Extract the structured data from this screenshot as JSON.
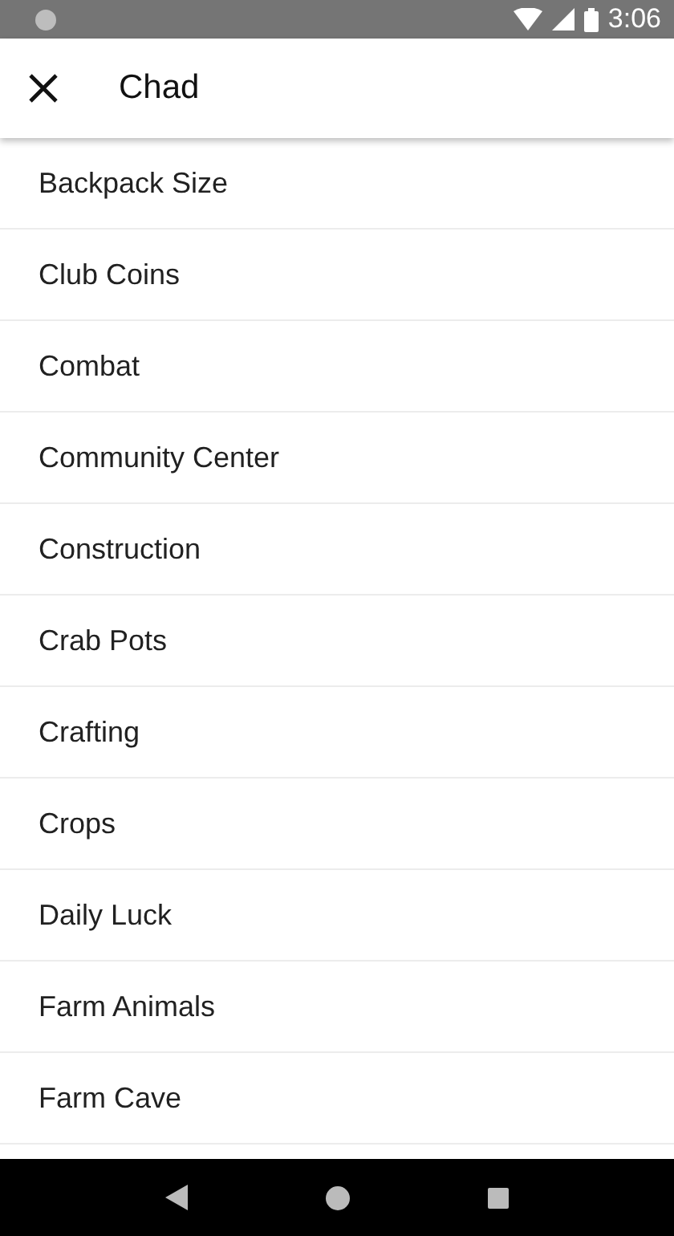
{
  "status_bar": {
    "time": "3:06"
  },
  "app_bar": {
    "title": "Chad"
  },
  "items": [
    {
      "label": "Backpack Size"
    },
    {
      "label": "Club Coins"
    },
    {
      "label": "Combat"
    },
    {
      "label": "Community Center"
    },
    {
      "label": "Construction"
    },
    {
      "label": "Crab Pots"
    },
    {
      "label": "Crafting"
    },
    {
      "label": "Crops"
    },
    {
      "label": "Daily Luck"
    },
    {
      "label": "Farm Animals"
    },
    {
      "label": "Farm Cave"
    }
  ]
}
